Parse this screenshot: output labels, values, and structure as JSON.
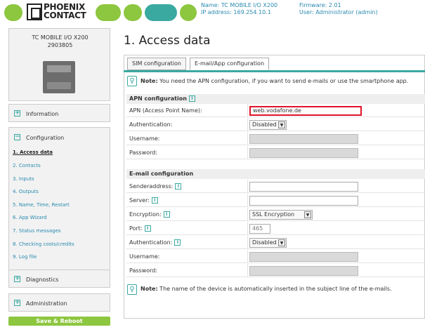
{
  "header": {
    "logo_text": "PHOENIX CONTACT",
    "name_line": "Name: TC MOBILE I/O X200",
    "ip_line": "IP address: 169.254.10.1",
    "firmware_line": "Firmware: 2.01",
    "user_line": "User: Administrator (admin)",
    "colors": {
      "teal": "#3aa9a0",
      "green": "#8dc63f"
    }
  },
  "sidebar": {
    "device_name": "TC MOBILE I/O X200",
    "device_number": "2903805",
    "information_label": "Information",
    "configuration_label": "Configuration",
    "config_items": [
      "1. Access data",
      "2. Contacts",
      "3. Inputs",
      "4. Outputs",
      "5. Name, Time, Restart",
      "6. App Wizard",
      "7. Status messages",
      "8. Checking costs/credits",
      "9. Log file"
    ],
    "active_item": "1. Access data",
    "diagnostics_label": "Diagnostics",
    "administration_label": "Administration",
    "save_label": "Save & Reboot"
  },
  "main": {
    "title": "1. Access data",
    "tabs": [
      "SIM configuration",
      "E-mail/App configuration"
    ],
    "active_tab": "E-mail/App configuration",
    "note_top_bold": "Note:",
    "note_top_text": " You need the APN configuration, if you want to send e-mails or use the smartphone app.",
    "apn": {
      "heading": "APN configuration",
      "apn_label": "APN (Access Point Name):",
      "apn_value": "web.vodafone.de",
      "auth_label": "Authentication:",
      "auth_value": "Disabled",
      "username_label": "Username:",
      "password_label": "Password:"
    },
    "email": {
      "heading": "E-mail configuration",
      "sender_label": "Senderaddress:",
      "server_label": "Server:",
      "encryption_label": "Encryption:",
      "encryption_value": "SSL Encryption",
      "port_label": "Port:",
      "port_value": "465",
      "auth_label": "Authentication:",
      "auth_value": "Disabled",
      "username_label": "Username:",
      "password_label": "Password:"
    },
    "note_bottom_bold": "Note:",
    "note_bottom_text": " The name of the device is automatically inserted in the subject line of the e-mails."
  }
}
